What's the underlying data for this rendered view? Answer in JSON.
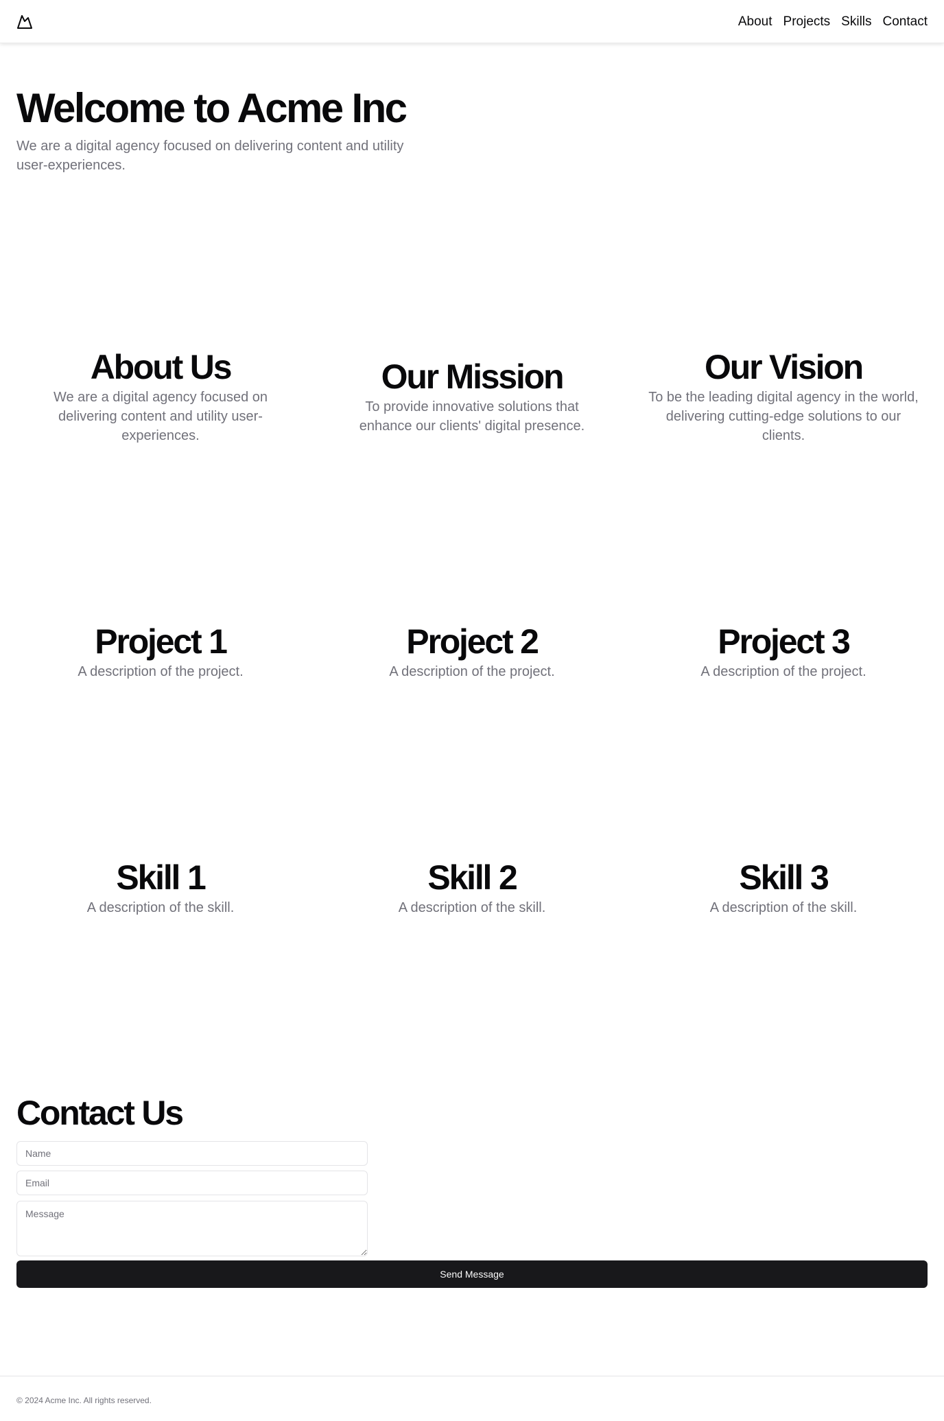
{
  "header": {
    "logo_icon": "mountain-icon",
    "nav": [
      {
        "label": "About"
      },
      {
        "label": "Projects"
      },
      {
        "label": "Skills"
      },
      {
        "label": "Contact"
      }
    ]
  },
  "hero": {
    "title": "Welcome to Acme Inc",
    "text": "We are a digital agency focused on delivering content and utility user-experiences."
  },
  "about": [
    {
      "title": "About Us",
      "text": "We are a digital agency focused on delivering content and utility user-experiences."
    },
    {
      "title": "Our Mission",
      "text": "To provide innovative solutions that enhance our clients' digital presence."
    },
    {
      "title": "Our Vision",
      "text": "To be the leading digital agency in the world, delivering cutting-edge solutions to our clients."
    }
  ],
  "projects": [
    {
      "title": "Project 1",
      "text": "A description of the project."
    },
    {
      "title": "Project 2",
      "text": "A description of the project."
    },
    {
      "title": "Project 3",
      "text": "A description of the project."
    }
  ],
  "skills": [
    {
      "title": "Skill 1",
      "text": "A description of the skill."
    },
    {
      "title": "Skill 2",
      "text": "A description of the skill."
    },
    {
      "title": "Skill 3",
      "text": "A description of the skill."
    }
  ],
  "contact": {
    "title": "Contact Us",
    "name_placeholder": "Name",
    "email_placeholder": "Email",
    "message_placeholder": "Message",
    "send_label": "Send Message"
  },
  "footer": {
    "text": "© 2024 Acme Inc. All rights reserved."
  },
  "colors": {
    "text": "#09090b",
    "muted": "#71717a",
    "button_bg": "#18181b",
    "border": "#e4e4e7"
  }
}
